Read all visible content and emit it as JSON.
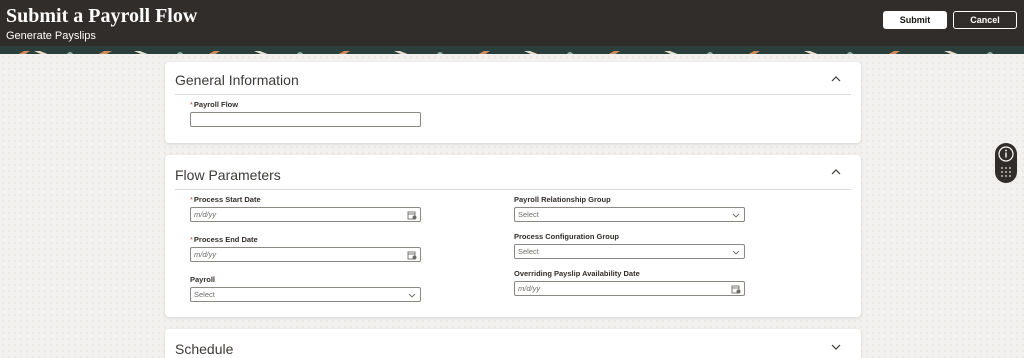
{
  "header": {
    "title": "Submit a Payroll Flow",
    "subtitle": "Generate Payslips",
    "submit_label": "Submit",
    "cancel_label": "Cancel"
  },
  "general_information": {
    "title": "General Information",
    "payroll_flow": {
      "label": "Payroll Flow",
      "required_marker": "*",
      "value": ""
    }
  },
  "flow_parameters": {
    "title": "Flow Parameters",
    "process_start_date": {
      "label": "Process Start Date",
      "required_marker": "*",
      "placeholder": "m/d/yy"
    },
    "process_end_date": {
      "label": "Process End Date",
      "required_marker": "*",
      "placeholder": "m/d/yy"
    },
    "payroll": {
      "label": "Payroll",
      "placeholder": "Select"
    },
    "payroll_relationship_group": {
      "label": "Payroll Relationship Group",
      "placeholder": "Select"
    },
    "process_configuration_group": {
      "label": "Process Configuration Group",
      "placeholder": "Select"
    },
    "overriding_payslip_date": {
      "label": "Overriding Payslip Availability Date",
      "placeholder": "m/d/yy"
    }
  },
  "schedule": {
    "title": "Schedule"
  },
  "icons": {
    "collapse": "chevron-up-icon",
    "expand": "chevron-down-icon",
    "calendar": "calendar-icon",
    "dropdown": "chevron-down-icon",
    "info": "info-icon",
    "apps": "grid-icon"
  },
  "colors": {
    "header_bg": "#312d2a",
    "page_bg": "#f1efed",
    "required": "#c74634"
  }
}
